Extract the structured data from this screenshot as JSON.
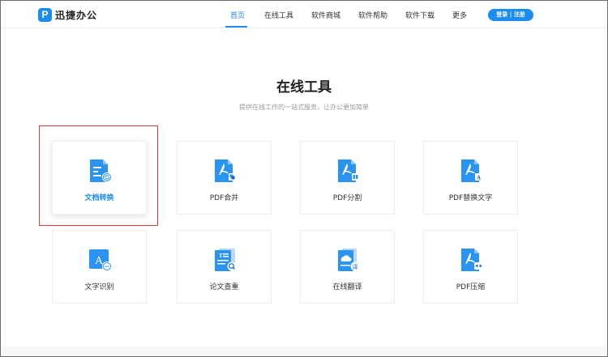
{
  "header": {
    "logo_mark": "P",
    "logo_text": "迅捷办公",
    "nav": [
      "首页",
      "在线工具",
      "软件商城",
      "软件帮助",
      "软件下载",
      "更多"
    ],
    "active_nav": "首页",
    "login_label": "登录 | 注册"
  },
  "main": {
    "title": "在线工具",
    "subtitle": "提供在线工作的一站式服务，让办公更加简单"
  },
  "tools": [
    {
      "label": "文档转换",
      "icon": "document-convert-icon",
      "featured": true
    },
    {
      "label": "PDF合并",
      "icon": "pdf-merge-icon"
    },
    {
      "label": "PDF分割",
      "icon": "pdf-split-icon"
    },
    {
      "label": "PDF替换文字",
      "icon": "pdf-replace-text-icon"
    },
    {
      "label": "文字识别",
      "icon": "text-recognition-icon"
    },
    {
      "label": "论文查重",
      "icon": "paper-check-icon"
    },
    {
      "label": "在线翻译",
      "icon": "online-translate-icon"
    },
    {
      "label": "PDF压缩",
      "icon": "pdf-compress-icon"
    }
  ],
  "colors": {
    "accent": "#1b8cf2",
    "highlight": "#e23a3a"
  }
}
